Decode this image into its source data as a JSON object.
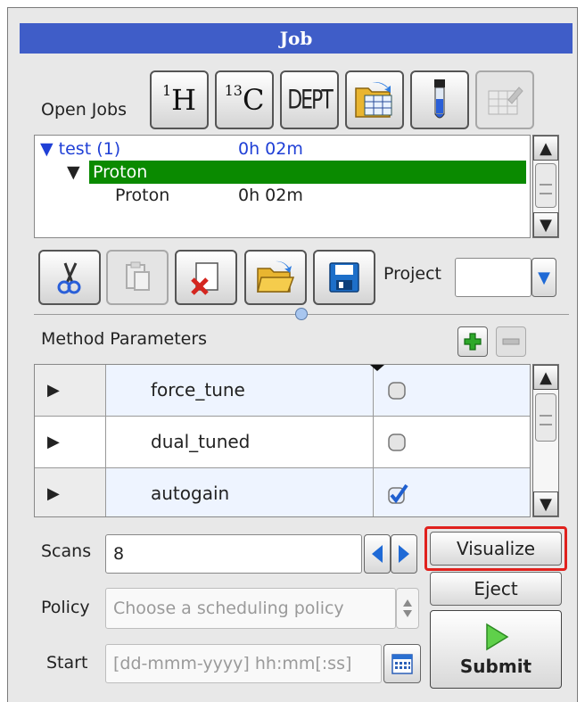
{
  "window": {
    "title": "Job"
  },
  "open_jobs": {
    "label": "Open Jobs",
    "toolbar": [
      {
        "name": "1h-button",
        "sup": "1",
        "text": "H"
      },
      {
        "name": "13c-button",
        "sup": "13",
        "text": "C"
      },
      {
        "name": "dept-button",
        "text": "DEPT"
      },
      {
        "name": "folder-table-button",
        "icon": "folder-table-icon"
      },
      {
        "name": "sample-tube-button",
        "icon": "sample-tube-icon"
      },
      {
        "name": "edit-disabled-button",
        "icon": "pencil-grid-icon"
      }
    ],
    "tree": [
      {
        "arrow": "▼",
        "name": "test (1)",
        "time": "0h 02m"
      },
      {
        "arrow": "▼",
        "name": "Proton",
        "time": ""
      },
      {
        "arrow": "",
        "name": "Proton",
        "time": "0h 02m"
      }
    ]
  },
  "edit_toolbar": {
    "project_label": "Project",
    "project_value": ""
  },
  "method_parameters": {
    "label": "Method Parameters",
    "rows": [
      {
        "name": "force_tune",
        "checked": false
      },
      {
        "name": "dual_tuned",
        "checked": false
      },
      {
        "name": "autogain",
        "checked": true
      }
    ]
  },
  "form": {
    "scans_label": "Scans",
    "scans_value": "8",
    "policy_label": "Policy",
    "policy_placeholder": "Choose a scheduling policy",
    "start_label": "Start",
    "start_placeholder": "[dd-mmm-yyyy] hh:mm[:ss]"
  },
  "actions": {
    "visualize": "Visualize",
    "eject": "Eject",
    "submit": "Submit"
  },
  "colors": {
    "title_bar": "#3f5dc8",
    "selection": "#0a8a00",
    "job_text": "#1f3fd6",
    "highlight": "#e0211d"
  }
}
